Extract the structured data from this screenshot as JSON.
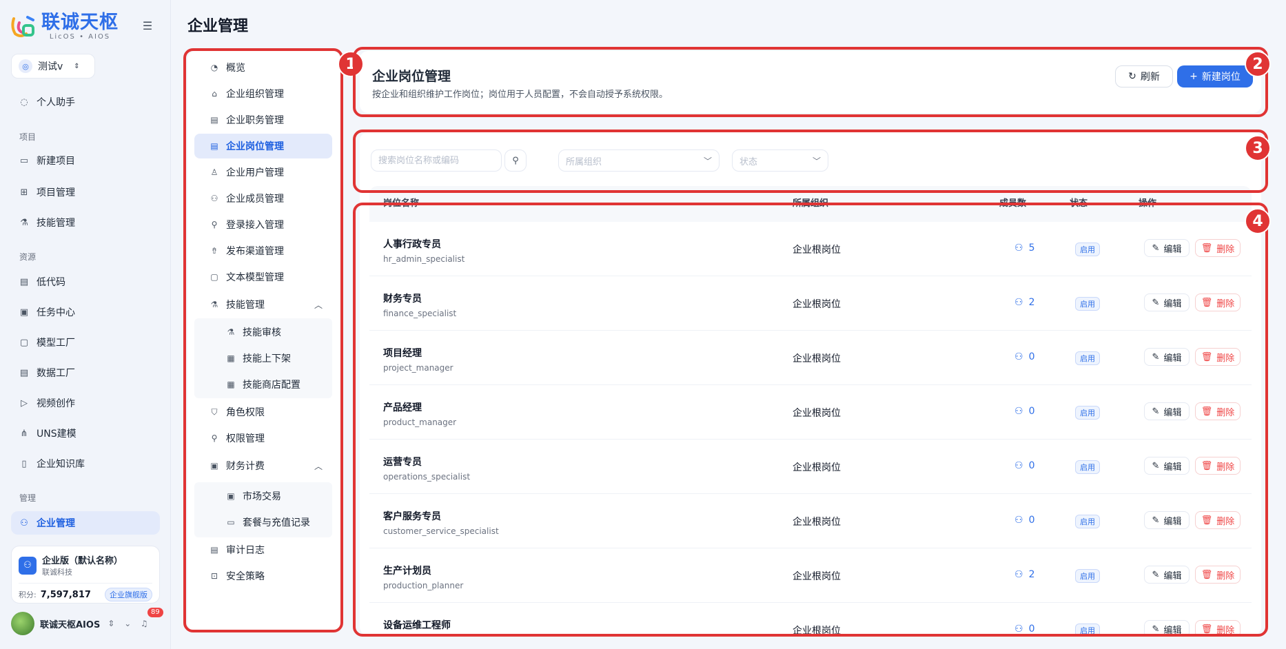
{
  "app": {
    "logo_title": "联诚天枢",
    "logo_sub": "LicOS • AIOS",
    "workspace": "测试v",
    "page_title": "企业管理"
  },
  "sidebar": {
    "assistant": "个人助手",
    "section_project": "项目",
    "project_items": [
      "新建项目",
      "项目管理",
      "技能管理"
    ],
    "section_resource": "资源",
    "resource_items": [
      "低代码",
      "任务中心",
      "模型工厂",
      "数据工厂",
      "视频创作",
      "UNS建模",
      "企业知识库"
    ],
    "section_manage": "管理",
    "manage_active": "企业管理"
  },
  "org_card": {
    "name": "企业版（默认名称）",
    "company": "联诚科技",
    "points_label": "积分:",
    "points": "7,597,817",
    "badge": "企业旗舰版"
  },
  "user": {
    "name": "联诚天枢AIOS",
    "notification_count": "89"
  },
  "sub_nav": {
    "items": [
      {
        "label": "概览",
        "icon": "dashboard-icon"
      },
      {
        "label": "企业组织管理",
        "icon": "building-icon"
      },
      {
        "label": "企业职务管理",
        "icon": "document-icon"
      },
      {
        "label": "企业岗位管理",
        "icon": "document-icon",
        "active": true
      },
      {
        "label": "企业用户管理",
        "icon": "user-icon"
      },
      {
        "label": "企业成员管理",
        "icon": "users-icon"
      },
      {
        "label": "登录接入管理",
        "icon": "key-icon"
      },
      {
        "label": "发布渠道管理",
        "icon": "rocket-icon"
      },
      {
        "label": "文本模型管理",
        "icon": "model-icon"
      },
      {
        "label": "技能管理",
        "icon": "flask-icon",
        "expanded": true
      },
      {
        "label": "技能审核",
        "icon": "flask-icon",
        "child": true
      },
      {
        "label": "技能上下架",
        "icon": "shelf-icon",
        "child": true
      },
      {
        "label": "技能商店配置",
        "icon": "store-icon",
        "child": true
      },
      {
        "label": "角色权限",
        "icon": "shield-icon"
      },
      {
        "label": "权限管理",
        "icon": "key-icon"
      },
      {
        "label": "财务计费",
        "icon": "wallet-icon",
        "expanded": true
      },
      {
        "label": "市场交易",
        "icon": "market-icon",
        "child": true
      },
      {
        "label": "套餐与充值记录",
        "icon": "card-icon",
        "child": true
      },
      {
        "label": "审计日志",
        "icon": "log-icon"
      },
      {
        "label": "安全策略",
        "icon": "lock-icon"
      }
    ]
  },
  "header": {
    "title": "企业岗位管理",
    "description": "按企业和组织维护工作岗位；岗位用于人员配置，不会自动授予系统权限。",
    "refresh_label": "刷新",
    "new_label": "新建岗位"
  },
  "filters": {
    "search_placeholder": "搜索岗位名称或编码",
    "org_placeholder": "所属组织",
    "status_placeholder": "状态"
  },
  "table": {
    "columns": [
      "岗位名称",
      "所属组织",
      "成员数",
      "状态",
      "操作"
    ],
    "edit_label": "编辑",
    "delete_label": "删除",
    "rows": [
      {
        "name": "人事行政专员",
        "code": "hr_admin_specialist",
        "org": "企业根岗位",
        "members": "5",
        "status": "启用"
      },
      {
        "name": "财务专员",
        "code": "finance_specialist",
        "org": "企业根岗位",
        "members": "2",
        "status": "启用"
      },
      {
        "name": "项目经理",
        "code": "project_manager",
        "org": "企业根岗位",
        "members": "0",
        "status": "启用"
      },
      {
        "name": "产品经理",
        "code": "product_manager",
        "org": "企业根岗位",
        "members": "0",
        "status": "启用"
      },
      {
        "name": "运营专员",
        "code": "operations_specialist",
        "org": "企业根岗位",
        "members": "0",
        "status": "启用"
      },
      {
        "name": "客户服务专员",
        "code": "customer_service_specialist",
        "org": "企业根岗位",
        "members": "0",
        "status": "启用"
      },
      {
        "name": "生产计划员",
        "code": "production_planner",
        "org": "企业根岗位",
        "members": "2",
        "status": "启用"
      },
      {
        "name": "设备运维工程师",
        "code": "",
        "org": "企业根岗位",
        "members": "0",
        "status": "启用"
      }
    ]
  },
  "callouts": [
    "1",
    "2",
    "3",
    "4"
  ],
  "colors": {
    "accent": "#2f6fe8",
    "danger": "#ef4444",
    "callout": "#e03434"
  }
}
